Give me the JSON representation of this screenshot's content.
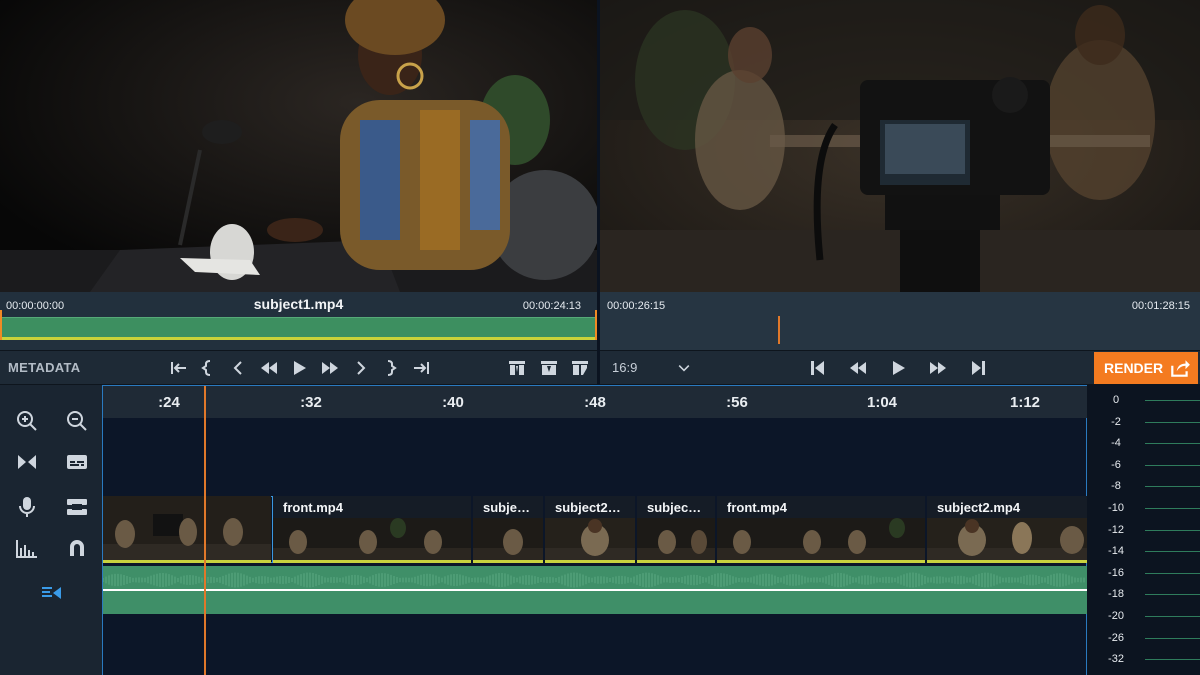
{
  "source": {
    "clip_name": "subject1.mp4",
    "tc_in": "00:00:00:00",
    "tc_out": "00:00:24:13"
  },
  "program": {
    "tc_in": "00:00:26:15",
    "tc_out": "00:01:28:15"
  },
  "toolbar": {
    "metadata_label": "METADATA",
    "aspect_ratio": "16:9",
    "render_label": "RENDER"
  },
  "ruler_ticks": [
    ":24",
    ":32",
    ":40",
    ":48",
    ":56",
    "1:04",
    "1:12"
  ],
  "video_clips": [
    {
      "name": ""
    },
    {
      "name": "front.mp4"
    },
    {
      "name": "subje…"
    },
    {
      "name": "subject2…"
    },
    {
      "name": "subjec…"
    },
    {
      "name": "front.mp4"
    },
    {
      "name": "subject2.mp4"
    }
  ],
  "meter_scale": [
    "0",
    "-2",
    "-4",
    "-6",
    "-8",
    "-10",
    "-12",
    "-14",
    "-16",
    "-18",
    "-20",
    "-26",
    "-32"
  ],
  "colors": {
    "accent": "#f47b20",
    "clip_green": "#3d8f60",
    "playhead": "#e0782a",
    "selection_blue": "#3a97e0"
  }
}
